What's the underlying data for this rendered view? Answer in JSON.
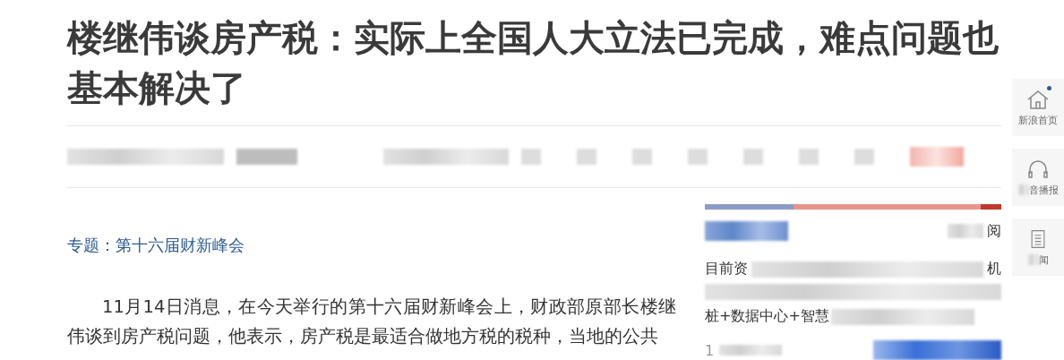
{
  "headline": "楼继伟谈房产税：实际上全国人大立法已完成，难点问题也基本解决了",
  "topic": {
    "label": "专题：",
    "link": "第十六届财新峰会"
  },
  "paragraph": "11月14日消息，在今天举行的第十六届财新峰会上，财政部原部长楼继伟谈到房产税问题，他表示，房产税是最适合做地方税的税种，当地的公共",
  "sidebar": {
    "read_label": "阅",
    "line_1_start": "目前资",
    "line_1_end": "机",
    "line_3_start": "桩+数据中心+智慧",
    "line_4_start": "1"
  },
  "float_toolbar": [
    {
      "kind": "home",
      "label": "新浪首页",
      "dot": true
    },
    {
      "kind": "audio",
      "label": "音播报",
      "dot": false
    },
    {
      "kind": "news",
      "label": "闻",
      "dot": false
    }
  ]
}
